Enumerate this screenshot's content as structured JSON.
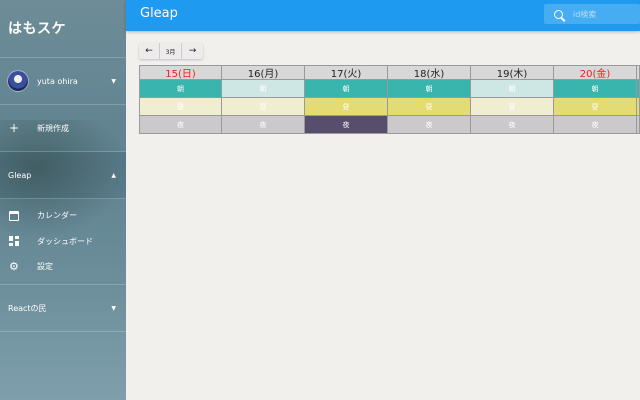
{
  "sidebar": {
    "brand": "はもスケ",
    "user": {
      "name": "yuta ohira"
    },
    "new_label": "新規作成",
    "sections": [
      {
        "label": "Gleap",
        "items": [
          "カレンダー",
          "ダッシュボード",
          "設定"
        ]
      },
      {
        "label": "Reactの民"
      }
    ]
  },
  "appbar": {
    "title": "Gleap",
    "search_placeholder": "id検索"
  },
  "month_nav": {
    "prev": "←",
    "month": "3月",
    "next": "→"
  },
  "calendar": {
    "days": [
      {
        "label": "15(日)",
        "holiday": true
      },
      {
        "label": "16(月)",
        "holiday": false
      },
      {
        "label": "17(火)",
        "holiday": false
      },
      {
        "label": "18(水)",
        "holiday": false
      },
      {
        "label": "19(木)",
        "holiday": false
      },
      {
        "label": "20(金)",
        "holiday": true
      }
    ],
    "shifts": [
      {
        "label": "朝",
        "colors": [
          "#3ab5ad",
          "#cfe7e4",
          "#3ab5ad",
          "#3ab5ad",
          "#cfe7e4",
          "#3ab5ad",
          "#3ab5ad"
        ]
      },
      {
        "label": "昼",
        "colors": [
          "#f0eed0",
          "#f0eed0",
          "#e2dc72",
          "#e2dc72",
          "#f0eed0",
          "#e2dc72",
          "#e2dc72"
        ]
      },
      {
        "label": "夜",
        "colors": [
          "#ccc9cd",
          "#ccc9cd",
          "#574d6c",
          "#ccc9cd",
          "#ccc9cd",
          "#ccc9cd",
          "#ccc9cd"
        ]
      }
    ],
    "holiday_color": "#e8211a"
  }
}
